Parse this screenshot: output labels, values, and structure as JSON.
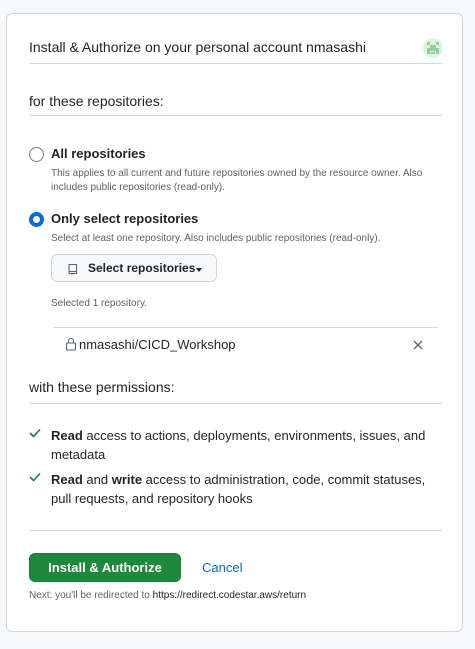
{
  "header": {
    "title": "Install & Authorize on your personal account nmasashi"
  },
  "repositories": {
    "section_title": "for these repositories:",
    "options": [
      {
        "label": "All repositories",
        "description": "This applies to all current and future repositories owned by the resource owner. Also includes public repositories (read-only).",
        "selected": false
      },
      {
        "label": "Only select repositories",
        "description": "Select at least one repository. Also includes public repositories (read-only).",
        "selected": true
      }
    ],
    "select_button_label": "Select repositories",
    "selected_count": "Selected 1 repository.",
    "selected_repos": [
      "nmasashi/CICD_Workshop"
    ]
  },
  "permissions": {
    "section_title": "with these permissions:",
    "items": [
      {
        "bold1": "Read",
        "text1": " access to actions, deployments, environments, issues, and metadata"
      },
      {
        "bold1": "Read",
        "mid": " and ",
        "bold2": "write",
        "text2": " access to administration, code, commit statuses, pull requests, and repository hooks"
      }
    ]
  },
  "actions": {
    "install_label": "Install & Authorize",
    "cancel_label": "Cancel",
    "next_prefix": "Next: you'll be redirected to ",
    "next_url": "https://redirect.codestar.aws/return"
  },
  "colors": {
    "primary_button": "#1f883d",
    "link": "#0969da",
    "radio_checked": "#0969da",
    "check": "#1a7f37",
    "avatar": "#8fd19e"
  }
}
